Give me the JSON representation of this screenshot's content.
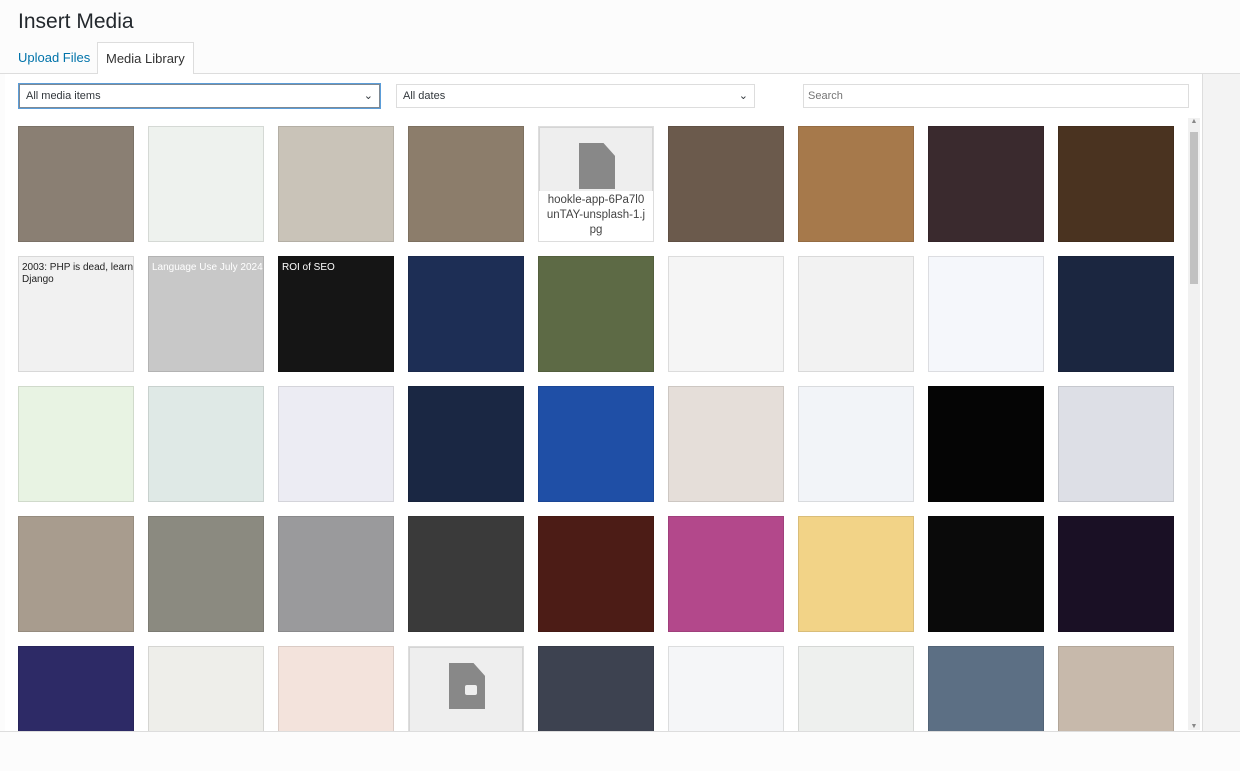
{
  "title": "Insert Media",
  "tabs": [
    {
      "label": "Upload Files",
      "active": false
    },
    {
      "label": "Media Library",
      "active": true
    }
  ],
  "filters": {
    "type": "All media items",
    "date": "All dates",
    "search_placeholder": "Search"
  },
  "colors": {
    "link": "#0073aa",
    "focus": "#5b9dd9"
  },
  "thumbnails": [
    {
      "kind": "image",
      "bg": "#8a7f73"
    },
    {
      "kind": "image",
      "bg": "#eef2ee"
    },
    {
      "kind": "image",
      "bg": "#c9c3b8"
    },
    {
      "kind": "image",
      "bg": "#8c7d6b"
    },
    {
      "kind": "file",
      "name": "hookle-app-6Pa7l0unTAY-unsplash-1.jpg"
    },
    {
      "kind": "image",
      "bg": "#6b5a4c"
    },
    {
      "kind": "image",
      "bg": "#a6794b"
    },
    {
      "kind": "image",
      "bg": "#3a2a2e"
    },
    {
      "kind": "image",
      "bg": "#4a3320"
    },
    {
      "kind": "image",
      "bg": "#f1f1f1",
      "text": "2003: PHP is dead, learn Django"
    },
    {
      "kind": "image",
      "bg": "#c8c8c8",
      "text": "Language Use July 2024"
    },
    {
      "kind": "image",
      "bg": "#151515",
      "text": "ROI of SEO"
    },
    {
      "kind": "image",
      "bg": "#1d2e55"
    },
    {
      "kind": "image",
      "bg": "#5d6a45"
    },
    {
      "kind": "image",
      "bg": "#f5f5f5"
    },
    {
      "kind": "image",
      "bg": "#f2f2f2"
    },
    {
      "kind": "image",
      "bg": "#f5f7fb"
    },
    {
      "kind": "image",
      "bg": "#1b2640"
    },
    {
      "kind": "image",
      "bg": "#e8f3e3"
    },
    {
      "kind": "image",
      "bg": "#dfe9e6"
    },
    {
      "kind": "image",
      "bg": "#ececf3"
    },
    {
      "kind": "image",
      "bg": "#1a2743"
    },
    {
      "kind": "image",
      "bg": "#1f4fa6"
    },
    {
      "kind": "image",
      "bg": "#e5ded9"
    },
    {
      "kind": "image",
      "bg": "#f2f4f8"
    },
    {
      "kind": "image",
      "bg": "#050505"
    },
    {
      "kind": "image",
      "bg": "#dddfe6"
    },
    {
      "kind": "image",
      "bg": "#a89c8e"
    },
    {
      "kind": "image",
      "bg": "#8b8a80"
    },
    {
      "kind": "image",
      "bg": "#9a9a9c"
    },
    {
      "kind": "image",
      "bg": "#3a3a3a"
    },
    {
      "kind": "image",
      "bg": "#4c1c16"
    },
    {
      "kind": "image",
      "bg": "#b3488b"
    },
    {
      "kind": "image",
      "bg": "#f2d387"
    },
    {
      "kind": "image",
      "bg": "#0a0a0a"
    },
    {
      "kind": "image",
      "bg": "#1a1025"
    },
    {
      "kind": "image",
      "bg": "#2d2a66"
    },
    {
      "kind": "image",
      "bg": "#eeeeea"
    },
    {
      "kind": "image",
      "bg": "#f3e3dc"
    },
    {
      "kind": "video"
    },
    {
      "kind": "image",
      "bg": "#3d4250"
    },
    {
      "kind": "image",
      "bg": "#f5f6f8"
    },
    {
      "kind": "image",
      "bg": "#eef0ee"
    },
    {
      "kind": "image",
      "bg": "#5c6f84"
    },
    {
      "kind": "image",
      "bg": "#c7b9ab"
    }
  ]
}
